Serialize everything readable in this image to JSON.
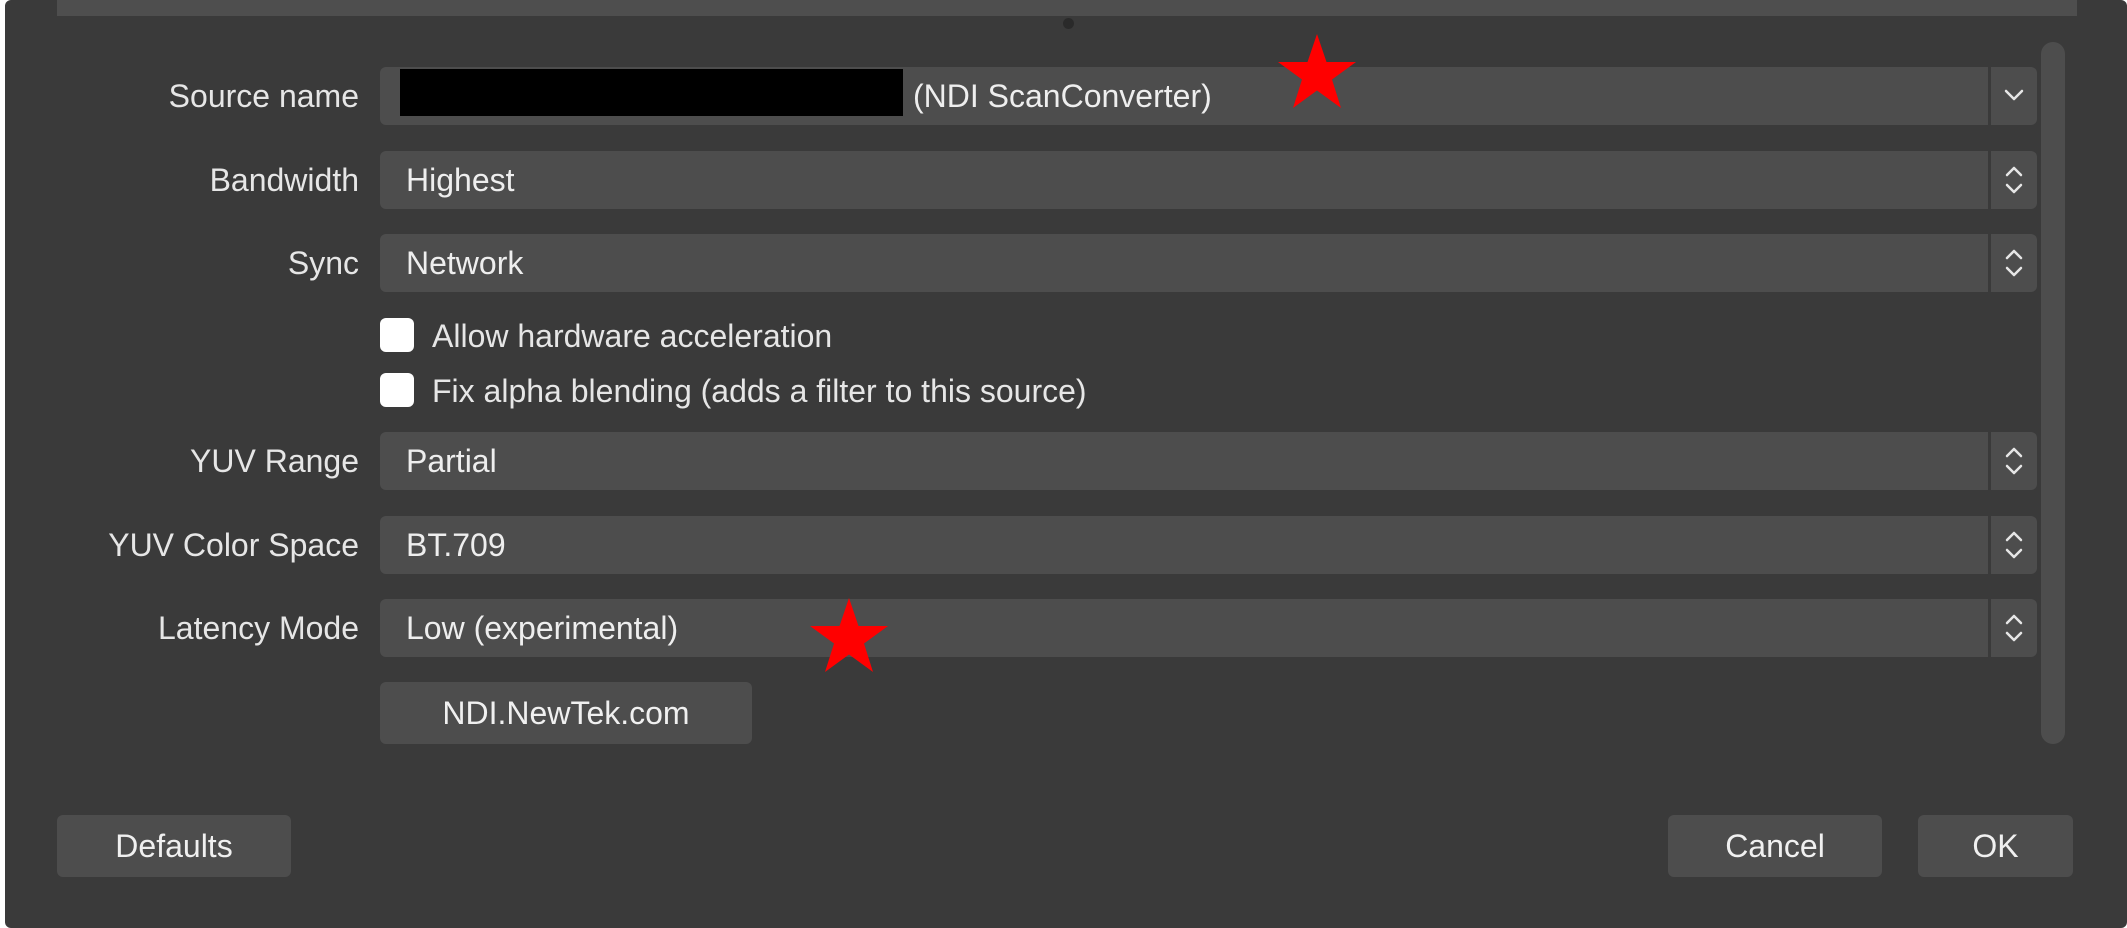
{
  "colors": {
    "dialog_bg": "#3a3a3a",
    "field_bg": "#4d4d4d",
    "text": "#e6e6e6",
    "annotation_star": "#ff0000"
  },
  "fields": {
    "source_name": {
      "label": "Source name",
      "value": "(NDI ScanConverter)",
      "control": "chevron-down-icon"
    },
    "bandwidth": {
      "label": "Bandwidth",
      "value": "Highest",
      "control": "up-down-stepper-icon"
    },
    "sync": {
      "label": "Sync",
      "value": "Network",
      "control": "up-down-stepper-icon"
    },
    "yuv_range": {
      "label": "YUV Range",
      "value": "Partial",
      "control": "up-down-stepper-icon"
    },
    "yuv_color_space": {
      "label": "YUV Color Space",
      "value": "BT.709",
      "control": "up-down-stepper-icon"
    },
    "latency_mode": {
      "label": "Latency Mode",
      "value": "Low (experimental)",
      "control": "up-down-stepper-icon"
    }
  },
  "checkboxes": {
    "hw_accel": {
      "label": "Allow hardware acceleration",
      "checked": false
    },
    "alpha_fix": {
      "label": "Fix alpha blending (adds a filter to this source)",
      "checked": false
    }
  },
  "buttons": {
    "ndi_link": "NDI.NewTek.com",
    "defaults": "Defaults",
    "cancel": "Cancel",
    "ok": "OK"
  },
  "annotations": [
    "star-icon",
    "star-icon"
  ]
}
